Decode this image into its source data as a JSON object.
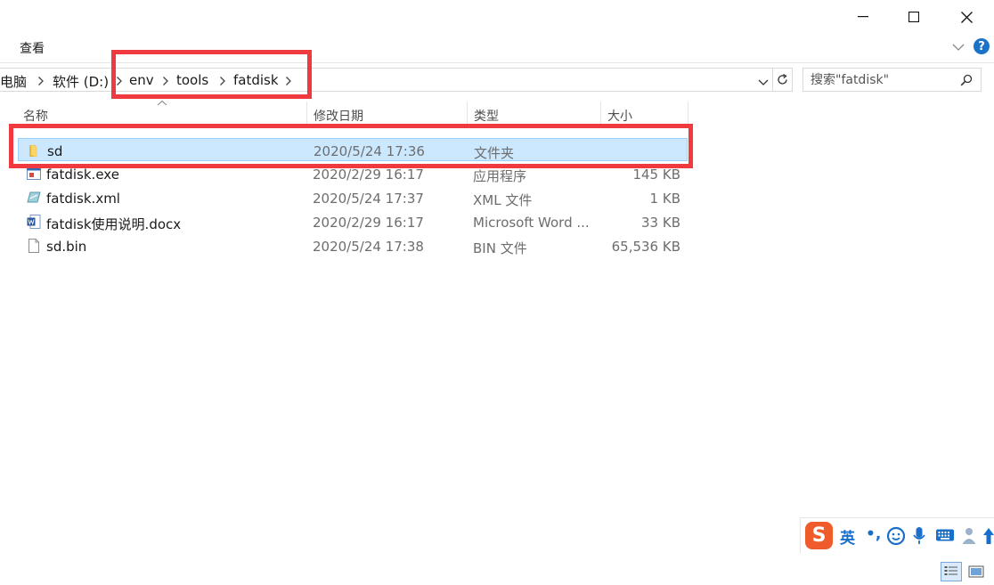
{
  "window": {
    "controls": [
      "minimize-icon",
      "maximize-icon",
      "close-icon"
    ]
  },
  "ribbon": {
    "view_tab": "查看",
    "help_label": "?"
  },
  "address": {
    "crumbs": [
      "电脑",
      "软件 (D:)",
      "env",
      "tools",
      "fatdisk"
    ]
  },
  "search": {
    "placeholder": "搜索\"fatdisk\""
  },
  "columns": {
    "name": "名称",
    "modified": "修改日期",
    "type": "类型",
    "size": "大小"
  },
  "files": [
    {
      "name": "sd",
      "modified": "2020/5/24 17:36",
      "type": "文件夹",
      "size": "",
      "icon": "folder-icon",
      "selected": true
    },
    {
      "name": "fatdisk.exe",
      "modified": "2020/2/29 16:17",
      "type": "应用程序",
      "size": "145 KB",
      "icon": "exe-icon",
      "selected": false
    },
    {
      "name": "fatdisk.xml",
      "modified": "2020/5/24 17:37",
      "type": "XML 文件",
      "size": "1 KB",
      "icon": "xml-file-icon",
      "selected": false
    },
    {
      "name": "fatdisk使用说明.docx",
      "modified": "2020/2/29 16:17",
      "type": "Microsoft Word ...",
      "size": "33 KB",
      "icon": "word-document-icon",
      "selected": false
    },
    {
      "name": "sd.bin",
      "modified": "2020/5/24 17:38",
      "type": "BIN 文件",
      "size": "65,536 KB",
      "icon": "blank-file-icon",
      "selected": false
    }
  ],
  "ime": {
    "logo": "S",
    "mode": "英",
    "punct": "•,"
  },
  "colors": {
    "selection_bg": "#cce8ff",
    "selection_border": "#99d1ff",
    "annotation_red": "#ef3a3f",
    "accent_blue": "#1a73c8"
  }
}
